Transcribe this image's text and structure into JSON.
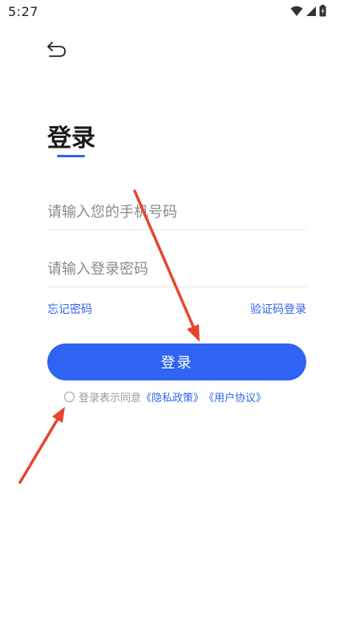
{
  "status_bar": {
    "time": "5:27",
    "icons": [
      "wifi-icon",
      "signal-icon",
      "battery-icon"
    ]
  },
  "header": {
    "back_icon": "back-arrow-icon"
  },
  "login": {
    "title": "登录",
    "phone_placeholder": "请输入您的手机号码",
    "password_placeholder": "请输入登录密码",
    "forgot_password": "忘记密码",
    "code_login": "验证码登录",
    "login_button": "登录"
  },
  "agreement": {
    "prefix": "登录表示同意",
    "privacy_policy": "《隐私政策》",
    "user_agreement": "《用户协议》"
  },
  "colors": {
    "accent": "#2f63f3",
    "annotation_arrow": "#e8442e"
  }
}
